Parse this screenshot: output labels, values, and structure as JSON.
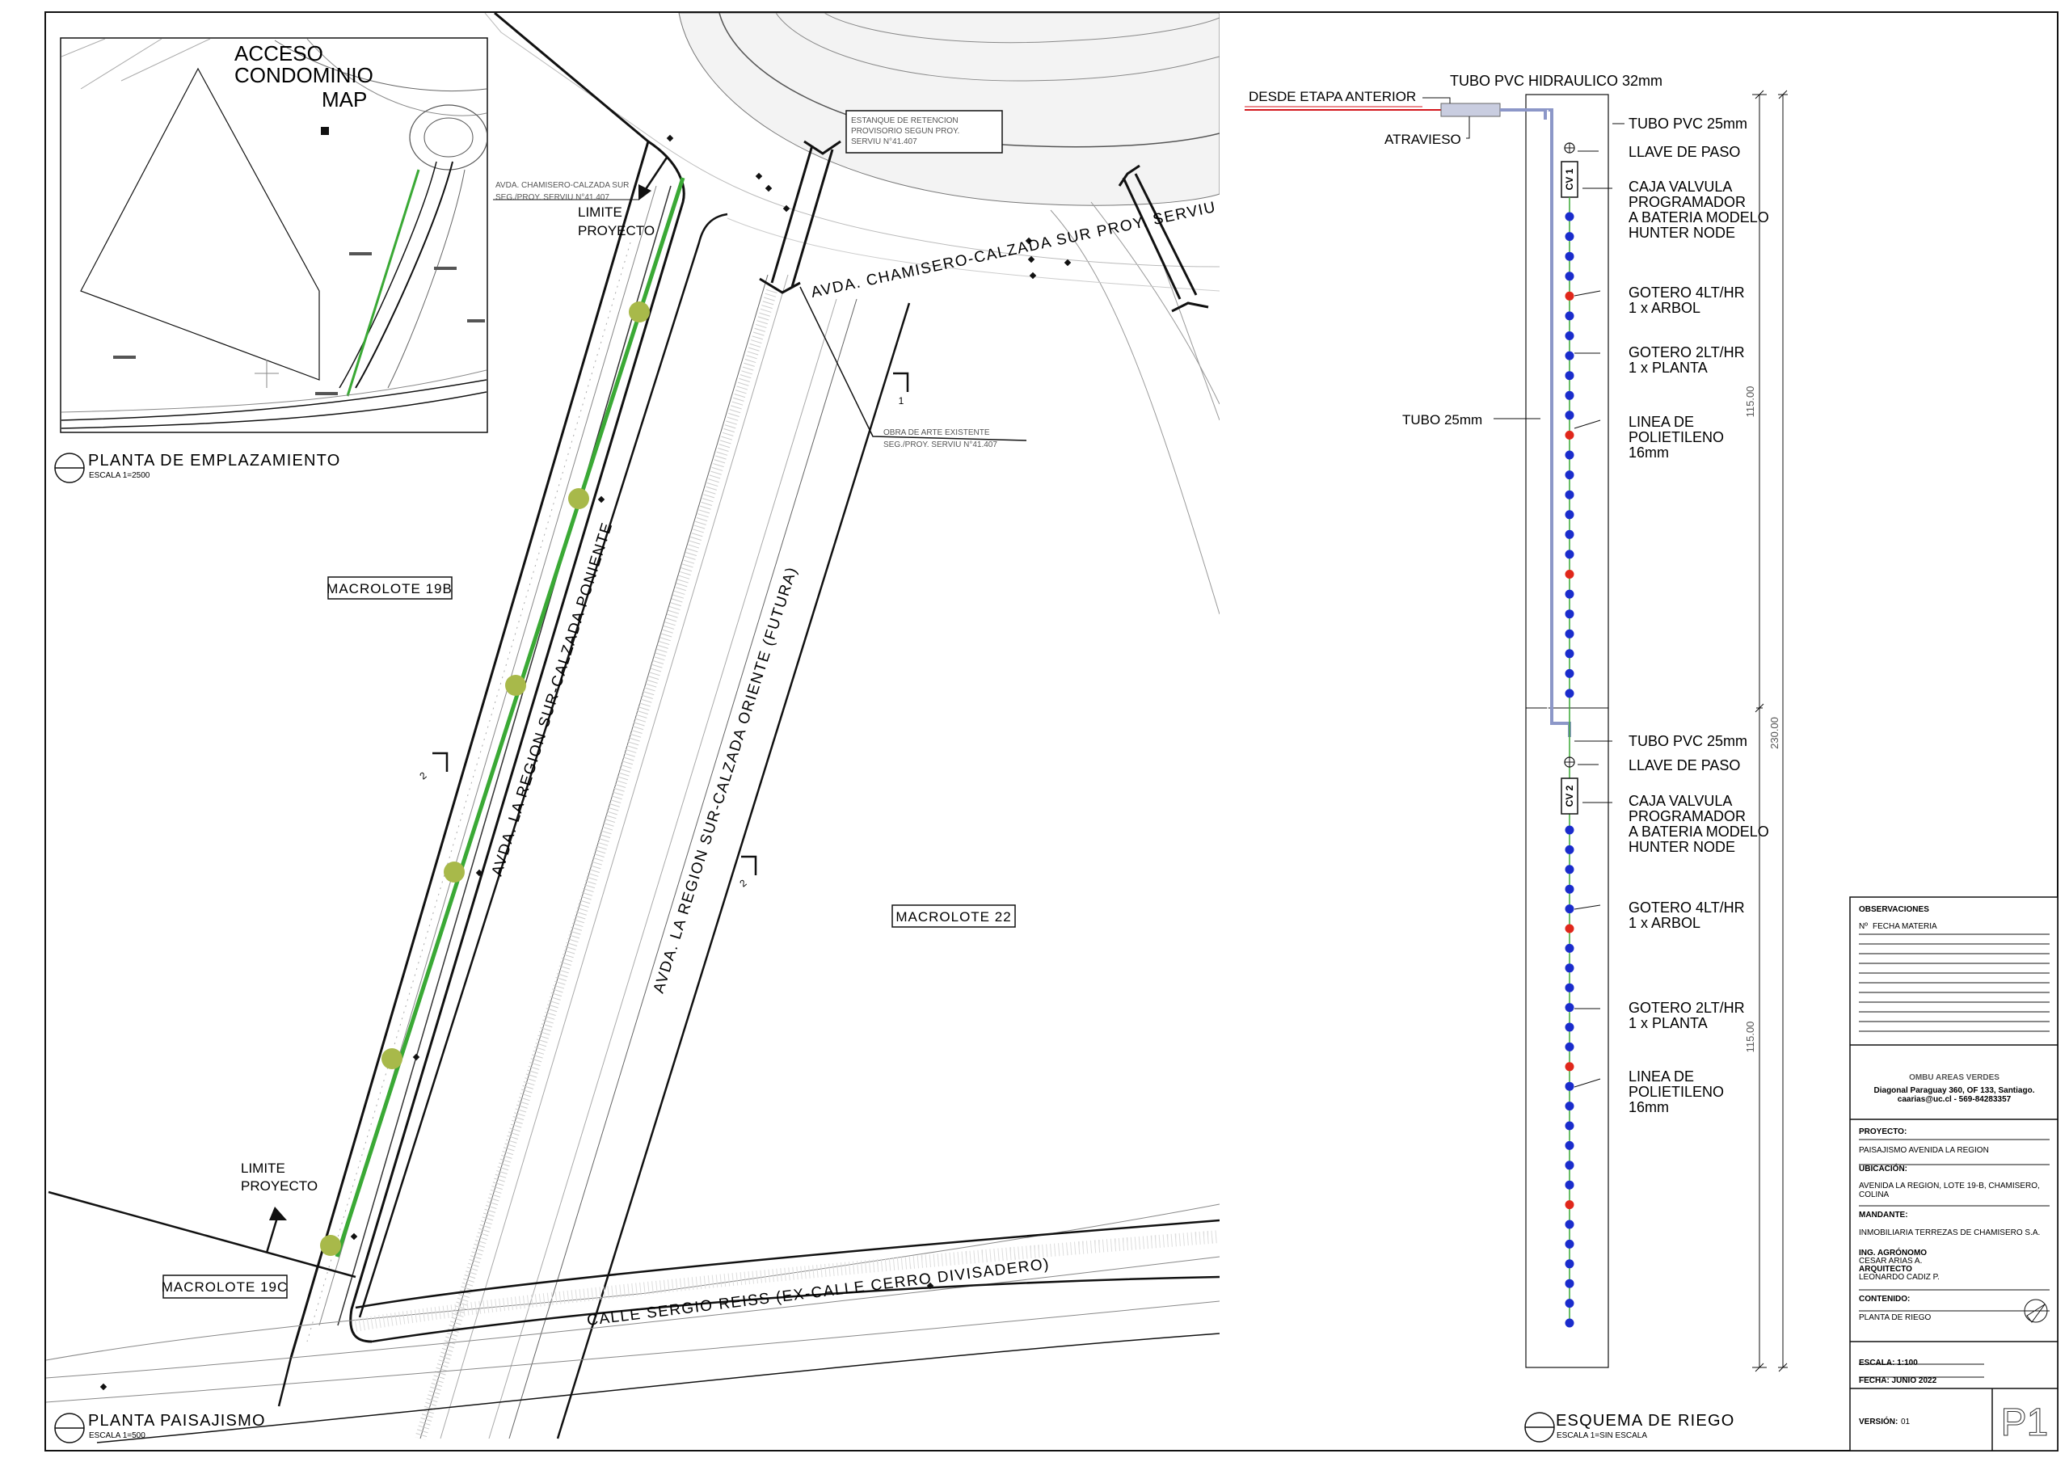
{
  "plan": {
    "inset_title": [
      "ACCESO",
      "CONDOMINIO",
      "MAP"
    ],
    "site_title": "PLANTA DE EMPLAZAMIENTO",
    "site_scale": "ESCALA 1=2500",
    "main_title": "PLANTA PAISAJISMO",
    "main_scale": "ESCALA 1=500",
    "macrolote_19b": "MACROLOTE 19B",
    "macrolote_22": "MACROLOTE 22",
    "macrolote_19c": "MACROLOTE 19C",
    "limite_top": [
      "LIMITE",
      "PROYECTO"
    ],
    "limite_bottom": [
      "LIMITE",
      "PROYECTO"
    ],
    "road_poniente": "AVDA. LA REGION SUR-CALZADA PONIENTE",
    "road_oriente": "AVDA. LA REGION SUR-CALZADA ORIENTE (FUTURA)",
    "road_chamisero": "AVDA. CHAMISERO-CALZADA SUR PROY. SERVIU N°41.407",
    "road_reiss": "CALLE SERGIO REISS (EX-CALLE CERRO DIVISADERO)",
    "small_chamisero": [
      "AVDA. CHAMISERO-CALZADA SUR",
      "SEG./PROY. SERVIU N°41.407"
    ],
    "estanque": [
      "ESTANQUE DE RETENCION",
      "PROVISORIO SEGUN PROY.",
      "SERVIU N°41.407"
    ],
    "obra": [
      "OBRA DE ARTE EXISTENTE",
      "SEG./PROY. SERVIU N°41.407"
    ],
    "section_1": "1",
    "section_2": "2"
  },
  "schema": {
    "title": "ESQUEMA DE RIEGO",
    "scale": "ESCALA 1=SIN ESCALA",
    "desde": "DESDE ETAPA ANTERIOR",
    "tubo_hidraulico": "TUBO PVC HIDRAULICO 32mm",
    "atravieso": "ATRAVIESO",
    "tubo_25": "TUBO 25mm",
    "tubo_pvc_25": "TUBO PVC 25mm",
    "llave": "LLAVE DE PASO",
    "caja": [
      "CAJA VALVULA",
      "PROGRAMADOR",
      "A BATERIA MODELO",
      "HUNTER NODE"
    ],
    "gotero4": [
      "GOTERO 4LT/HR",
      "1 x ARBOL"
    ],
    "gotero2": [
      "GOTERO 2LT/HR",
      "1 x PLANTA"
    ],
    "linea": [
      "LINEA DE",
      "POLIETILENO",
      "16mm"
    ],
    "cv1": "CV 1",
    "cv2": "CV 2",
    "dim_half": "115.00",
    "dim_total": "230.00"
  },
  "titleblock": {
    "observaciones": "OBSERVACIONES",
    "col_n": "Nº",
    "col_fecha": "FECHA",
    "col_materia": "MATERIA",
    "firm": "OMBU AREAS VERDES",
    "firm_addr": "Diagonal Paraguay 360, OF 133, Santiago.",
    "firm_contact": "caarias@uc.cl - 569-84283357",
    "proyecto_label": "PROYECTO:",
    "proyecto": "PAISAJISMO AVENIDA LA REGION",
    "ubicacion_label": "UBICACIÓN:",
    "ubicacion": [
      "AVENIDA LA REGION, LOTE 19-B, CHAMISERO,",
      "COLINA"
    ],
    "mandante_label": "MANDANTE:",
    "mandante": "INMOBILIARIA TERREZAS DE CHAMISERO S.A.",
    "agronomo_label": "ING. AGRÓNOMO",
    "agronomo": "CESAR ARIAS A.",
    "arquitecto_label": "ARQUITECTO",
    "arquitecto": "LEONARDO CADIZ P.",
    "contenido_label": "CONTENIDO:",
    "contenido": "PLANTA DE RIEGO",
    "escala": "ESCALA: 1:100",
    "fecha": "FECHA: JUNIO 2022",
    "version_label": "VERSIÓN:",
    "version": "01",
    "sheet": "P1"
  },
  "colors": {
    "line": "#111111",
    "green_strip": "#3aa935",
    "tree": "#a8b94a",
    "emitter": "#1a2ccc",
    "emitter_tree": "#e0271b",
    "pipe_red": "#d4161c",
    "pipe_blue": "#8c97c8"
  }
}
